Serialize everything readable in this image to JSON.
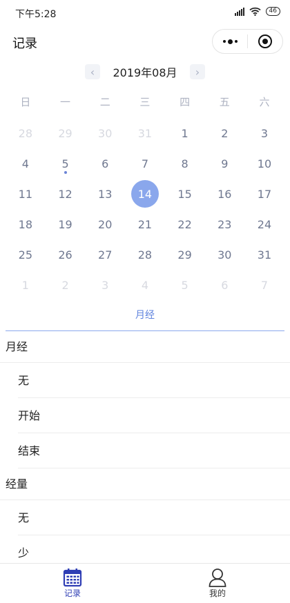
{
  "status": {
    "time": "下午5:28",
    "battery": "46"
  },
  "title": "记录",
  "month_label": "2019年08月",
  "weekdays": [
    "日",
    "一",
    "二",
    "三",
    "四",
    "五",
    "六"
  ],
  "weeks": [
    [
      "28",
      "29",
      "30",
      "31",
      "1",
      "2",
      "3"
    ],
    [
      "4",
      "5",
      "6",
      "7",
      "8",
      "9",
      "10"
    ],
    [
      "11",
      "12",
      "13",
      "14",
      "15",
      "16",
      "17"
    ],
    [
      "18",
      "19",
      "20",
      "21",
      "22",
      "23",
      "24"
    ],
    [
      "25",
      "26",
      "27",
      "28",
      "29",
      "30",
      "31"
    ],
    [
      "1",
      "2",
      "3",
      "4",
      "5",
      "6",
      "7"
    ]
  ],
  "selected_date": "14",
  "marked_date": "5",
  "tab_label": "月经",
  "sections": [
    {
      "title": "月经",
      "options": [
        "无",
        "开始",
        "结束"
      ]
    },
    {
      "title": "经量",
      "options": [
        "无",
        "少"
      ]
    }
  ],
  "tabbar": {
    "record": "记录",
    "mine": "我的"
  },
  "colors": {
    "accent": "#8aa7ec",
    "tab_active": "#2e3db4",
    "mark": "#6b84d6"
  }
}
